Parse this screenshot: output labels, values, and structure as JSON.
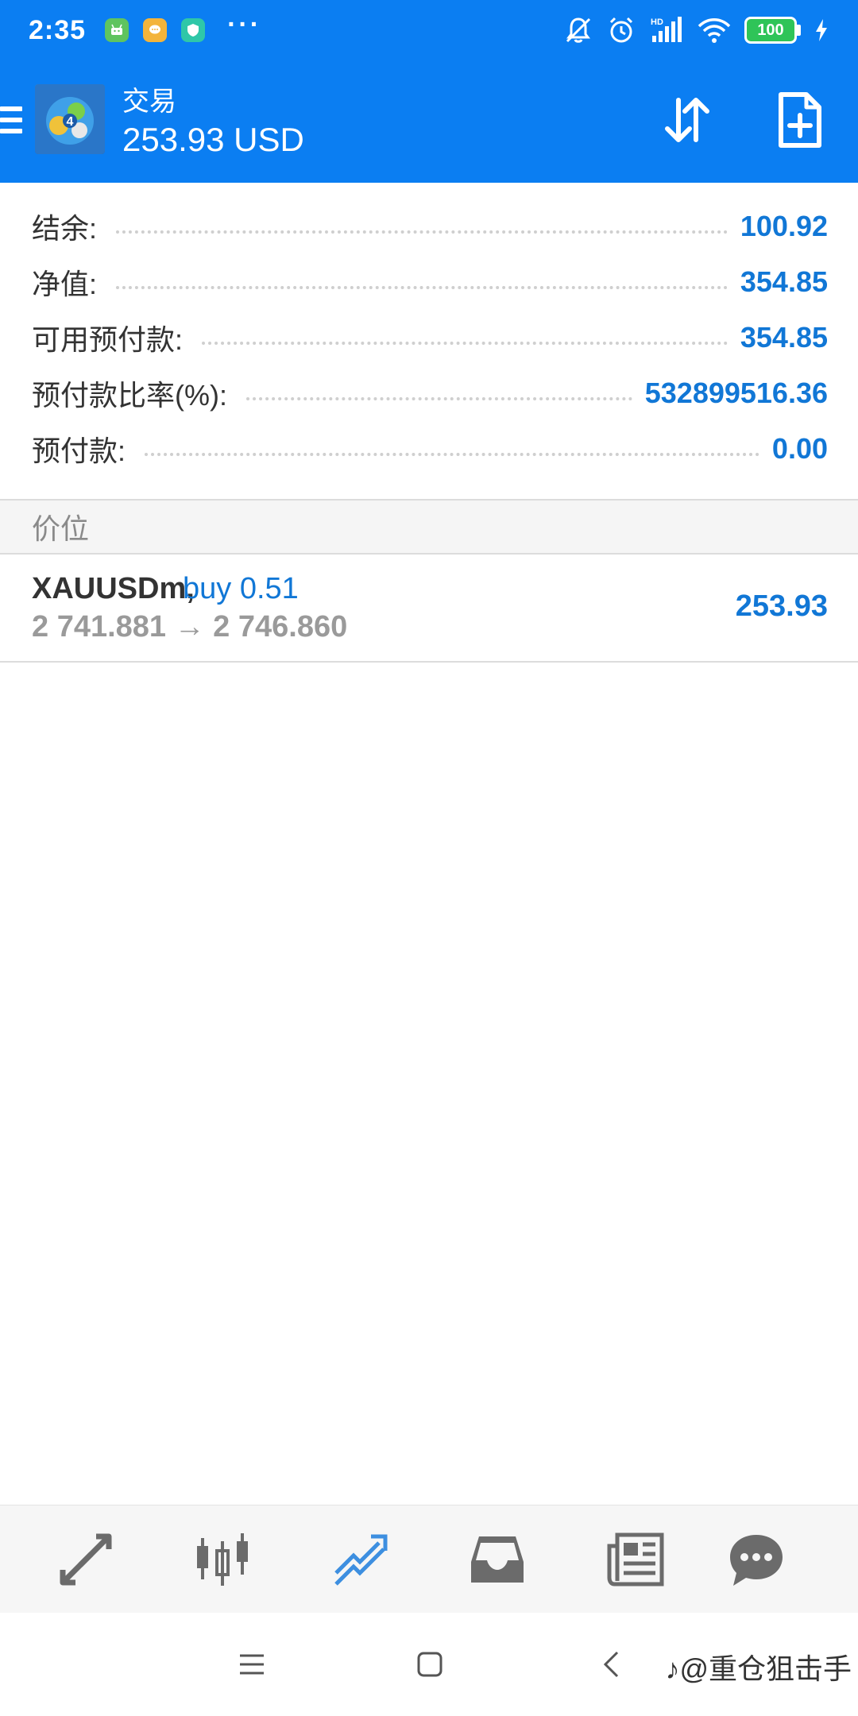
{
  "status_bar": {
    "time": "2:35",
    "dots": "···",
    "battery": "100"
  },
  "app_bar": {
    "title": "交易",
    "subtitle": "253.93 USD"
  },
  "summary": [
    {
      "label": "结余:",
      "value": "100.92"
    },
    {
      "label": "净值:",
      "value": "354.85"
    },
    {
      "label": "可用预付款:",
      "value": "354.85"
    },
    {
      "label": "预付款比率(%):",
      "value": "532899516.36"
    },
    {
      "label": "预付款:",
      "value": "0.00"
    }
  ],
  "positions_header": "价位",
  "position": {
    "symbol": "XAUUSDm,",
    "type": "buy 0.51",
    "prices": "2 741.881 → 2 746.860",
    "profit": "253.93"
  },
  "tabs": [
    {
      "name": "quotes-icon"
    },
    {
      "name": "chart-icon"
    },
    {
      "name": "trade-icon",
      "active": true
    },
    {
      "name": "history-icon"
    },
    {
      "name": "news-icon"
    },
    {
      "name": "chat-icon"
    }
  ],
  "colors": {
    "primary": "#0b7ef2",
    "value_blue": "#1177d6",
    "tab_active": "#3d8fe0",
    "tab_inactive": "#6b6b6b"
  },
  "watermark": "@重仓狙击手"
}
